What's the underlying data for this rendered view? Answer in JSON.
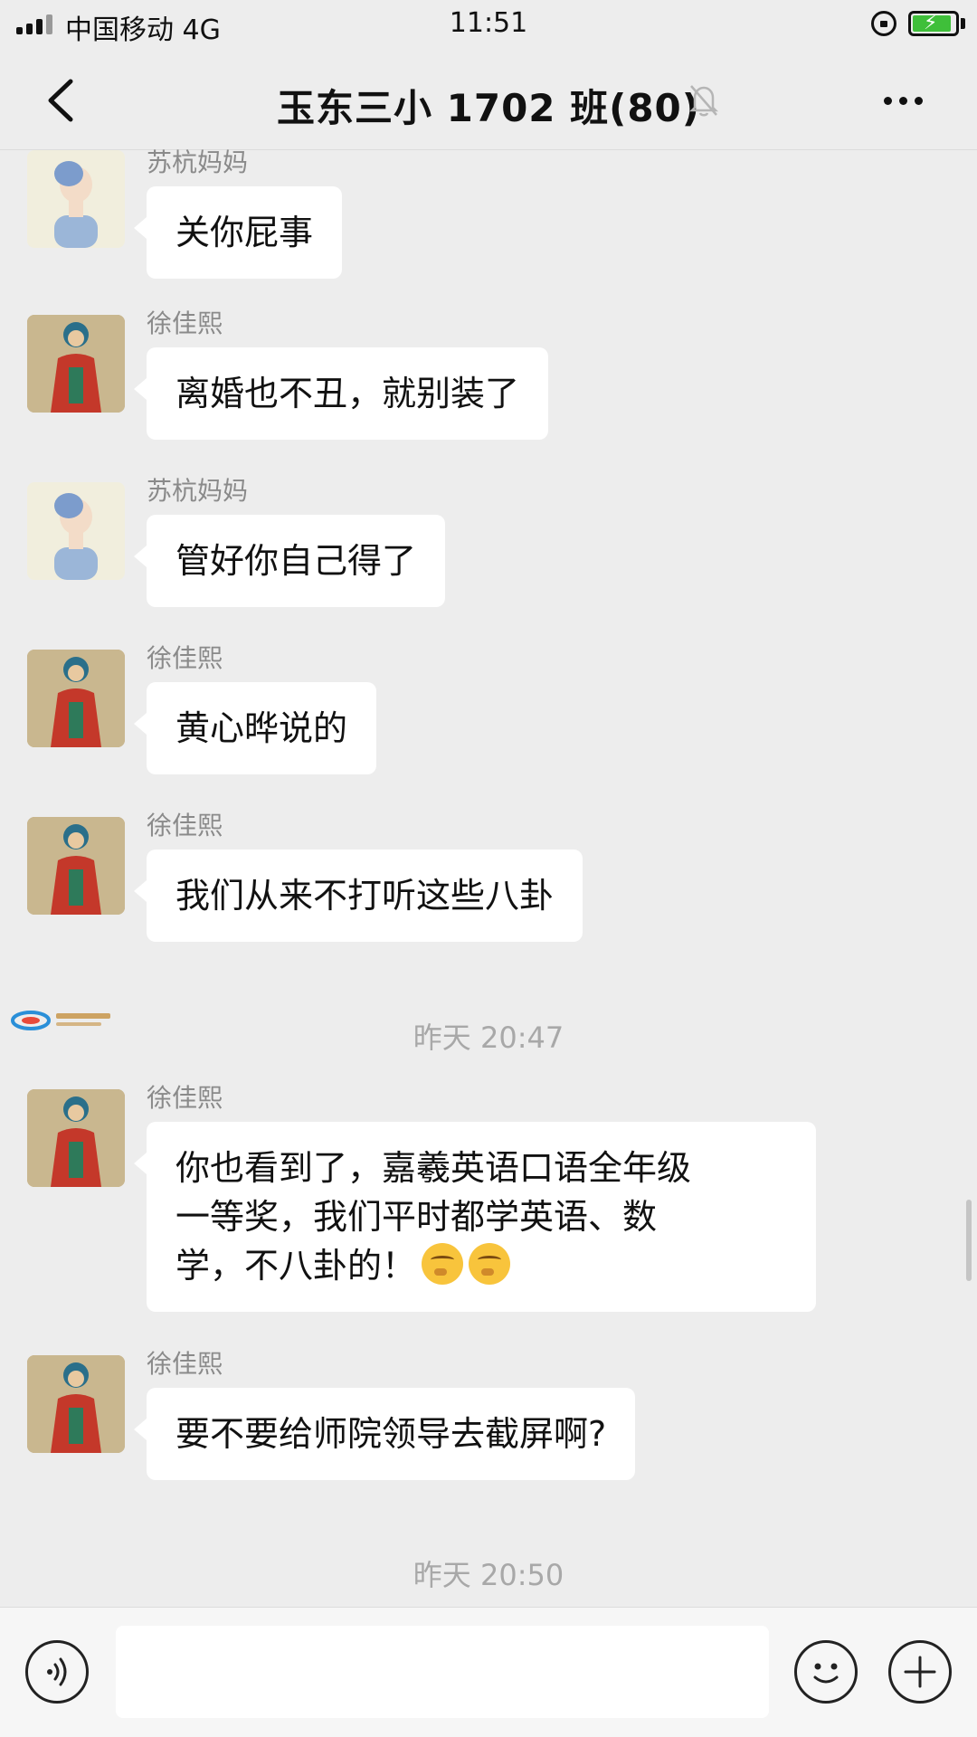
{
  "status_bar": {
    "carrier": "中国移动 4G",
    "time": "11:51",
    "icons": [
      "signal-icon",
      "rotation-lock-icon",
      "battery-charging-icon"
    ]
  },
  "nav": {
    "back_icon": "chevron-left-icon",
    "title": "玉东三小 1702 班(80)",
    "mute_icon": "bell-muted-icon",
    "more_icon": "more-horizontal-icon"
  },
  "messages": [
    {
      "sender": "苏杭妈妈",
      "avatar": "avatar-lady-portrait",
      "text": "关你屁事"
    },
    {
      "sender": "徐佳熙",
      "avatar": "avatar-monk-painting",
      "text": "离婚也不丑，就别装了"
    },
    {
      "sender": "苏杭妈妈",
      "avatar": "avatar-lady-portrait",
      "text": "管好你自己得了"
    },
    {
      "sender": "徐佳熙",
      "avatar": "avatar-monk-painting",
      "text": "黄心晔说的"
    },
    {
      "sender": "徐佳熙",
      "avatar": "avatar-monk-painting",
      "text": "我们从来不打听这些八卦"
    },
    {
      "sender": "徐佳熙",
      "avatar": "avatar-monk-painting",
      "lines": [
        "你也看到了，嘉羲英语口语全年级",
        "一等奖，我们平时都学英语、数",
        "学，不八卦的！"
      ],
      "emojis": [
        "thinking-face-emoji",
        "thinking-face-emoji"
      ]
    },
    {
      "sender": "徐佳熙",
      "avatar": "avatar-monk-painting",
      "text": "要不要给师院领导去截屏啊?"
    }
  ],
  "timestamps": [
    "昨天 20:47",
    "昨天 20:50"
  ],
  "input_bar": {
    "voice_icon": "voice-icon",
    "input_value": "",
    "emoji_icon": "smiley-icon",
    "plus_icon": "plus-circle-icon"
  },
  "colors": {
    "background": "#ededed",
    "bubble": "#ffffff",
    "sender_name": "#8a8a8a",
    "timestamp": "#a8a8a8",
    "battery": "#3fbf3a"
  }
}
